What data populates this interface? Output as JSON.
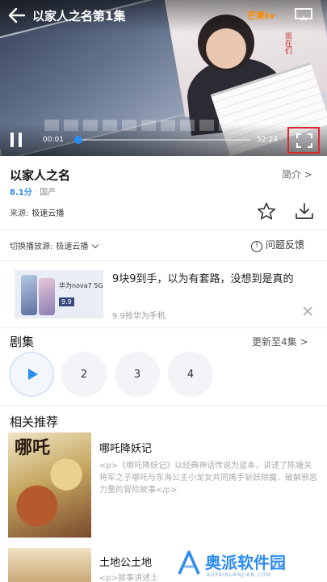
{
  "player": {
    "title": "以家人之名第1集",
    "brand": "芒果tv",
    "time_current": "00:01",
    "time_total": "52:24",
    "progress": 0.01,
    "stamp": "现在们"
  },
  "info": {
    "show_title": "以家人之名",
    "intro_label": "简介 >",
    "rating": "8.1分",
    "region": "国产",
    "source_label": "来源:",
    "source_value": "极速云播"
  },
  "switch": {
    "label": "切换播放源:",
    "value": "极速云播",
    "feedback_label": "问题反馈"
  },
  "ad": {
    "model": "华为nova7 5G",
    "price": "9.9",
    "headline": "9块9到手，以为有套路，没想到是真的",
    "sub": "9.9抢华为手机"
  },
  "episodes": {
    "section_title": "剧集",
    "update_label": "更新至4集 >",
    "items": [
      "2",
      "3",
      "4"
    ]
  },
  "recommend": {
    "section_title": "相关推荐",
    "items": [
      {
        "poster_title": "哪吒",
        "title": "哪吒降妖记",
        "desc": "<p>《哪吒降妖记》以经典神话传说为蓝本，讲述了陈塘关将军之子哪吒与东海公主小龙女共同携手斩妖除魔、破解邪恶力量的冒险故事</p>"
      },
      {
        "title": "土地公土地",
        "desc": "<p>故事讲述土"
      }
    ]
  },
  "watermark": {
    "text": "奥派软件园",
    "sub": "AUPAIRUANJIAN.COM"
  },
  "colors": {
    "accent": "#2d8cf0",
    "highlight": "#e0262d"
  }
}
